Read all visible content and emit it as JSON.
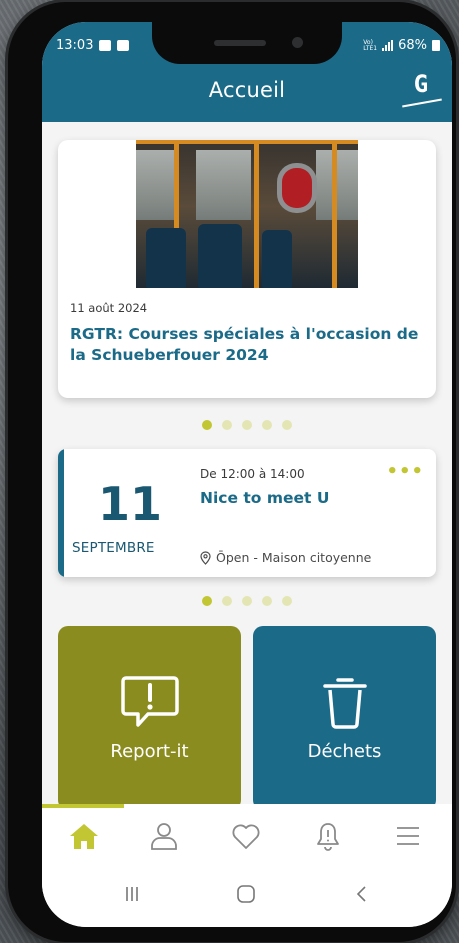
{
  "status_bar": {
    "time": "13:03",
    "network": "VoLTE1",
    "battery": "68%"
  },
  "header": {
    "title": "Accueil",
    "logo_letter": "G"
  },
  "news": {
    "date": "11 août 2024",
    "title": "RGTR: Courses spéciales à l'occasion de la Schueberfouer 2024",
    "carousel_active_index": 0,
    "carousel_count": 5
  },
  "event": {
    "day": "11",
    "month": "SEPTEMBRE",
    "time": "De 12:00 à 14:00",
    "title": "Nice to meet U",
    "location": "Ōpen - Maison citoyenne",
    "more": "•••",
    "carousel_active_index": 0,
    "carousel_count": 5
  },
  "tiles": {
    "report_label": "Report-it",
    "waste_label": "Déchets"
  },
  "nav": {
    "items": [
      "home",
      "profile",
      "favorites",
      "notifications",
      "menu"
    ],
    "active": "home"
  },
  "colors": {
    "primary": "#1b6a88",
    "accent": "#c2c632",
    "report_tile": "#8b8c1f"
  }
}
